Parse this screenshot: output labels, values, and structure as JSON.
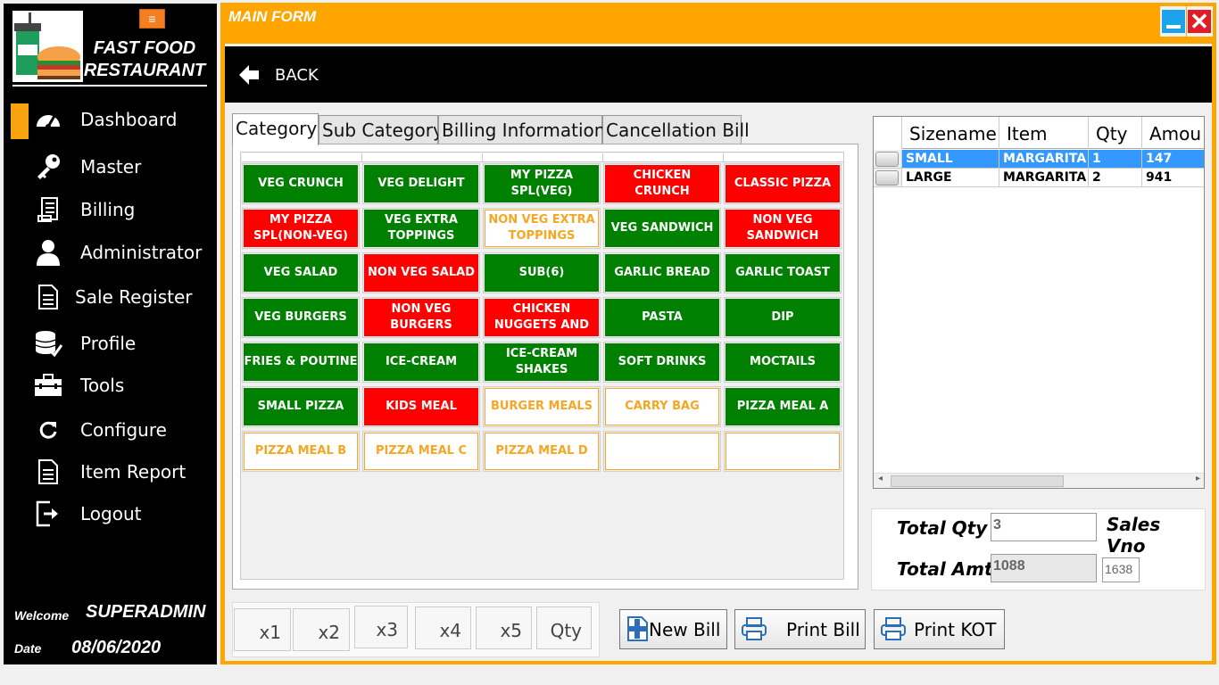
{
  "sidebar": {
    "brand": "FAST FOOD RESTAURANT",
    "menu_icon": "hamburger-icon",
    "items": [
      {
        "label": "Dashboard",
        "icon": "dashboard-gauge-icon"
      },
      {
        "label": "Master",
        "icon": "key-icon"
      },
      {
        "label": "Billing",
        "icon": "receipt-icon"
      },
      {
        "label": "Administrator",
        "icon": "user-icon"
      },
      {
        "label": "Sale Register",
        "icon": "document-icon"
      },
      {
        "label": "Profile",
        "icon": "database-check-icon"
      },
      {
        "label": "Tools",
        "icon": "toolbox-icon"
      },
      {
        "label": "Configure",
        "icon": "refresh-icon"
      },
      {
        "label": "Item Report",
        "icon": "document-icon"
      },
      {
        "label": "Logout",
        "icon": "logout-icon"
      }
    ],
    "welcome_label": "Welcome",
    "welcome_user": "SUPERADMIN",
    "date_label": "Date",
    "date_value": "08/06/2020",
    "accent_color": "#f7a20e"
  },
  "window": {
    "title": "MAIN FORM",
    "back_label": "BACK",
    "frame_color": "#ffa500"
  },
  "tabs": [
    "Category",
    "Sub Category",
    "Billing Information",
    "Cancellation Bill"
  ],
  "categories": [
    {
      "label": "VEG CRUNCH",
      "style": "green"
    },
    {
      "label": "VEG DELIGHT",
      "style": "green"
    },
    {
      "label": "MY PIZZA SPL(VEG)",
      "style": "green"
    },
    {
      "label": "CHICKEN CRUNCH",
      "style": "red"
    },
    {
      "label": "CLASSIC PIZZA",
      "style": "red"
    },
    {
      "label": "MY PIZZA SPL(NON-VEG)",
      "style": "red"
    },
    {
      "label": "VEG EXTRA TOPPINGS",
      "style": "green"
    },
    {
      "label": "NON VEG EXTRA TOPPINGS",
      "style": "white"
    },
    {
      "label": "VEG SANDWICH",
      "style": "green"
    },
    {
      "label": "NON VEG SANDWICH",
      "style": "red"
    },
    {
      "label": "VEG SALAD",
      "style": "green"
    },
    {
      "label": "NON VEG SALAD",
      "style": "red"
    },
    {
      "label": "SUB(6)",
      "style": "green"
    },
    {
      "label": "GARLIC BREAD",
      "style": "green"
    },
    {
      "label": "GARLIC TOAST",
      "style": "green"
    },
    {
      "label": "VEG BURGERS",
      "style": "green"
    },
    {
      "label": "NON VEG BURGERS",
      "style": "red"
    },
    {
      "label": "CHICKEN NUGGETS AND",
      "style": "red"
    },
    {
      "label": "PASTA",
      "style": "green"
    },
    {
      "label": "DIP",
      "style": "green"
    },
    {
      "label": "FRIES & POUTINE",
      "style": "green"
    },
    {
      "label": "ICE-CREAM",
      "style": "green"
    },
    {
      "label": "ICE-CREAM SHAKES",
      "style": "green"
    },
    {
      "label": "SOFT DRINKS",
      "style": "green"
    },
    {
      "label": "MOCTAILS",
      "style": "green"
    },
    {
      "label": "SMALL PIZZA",
      "style": "green"
    },
    {
      "label": "KIDS MEAL",
      "style": "red"
    },
    {
      "label": "BURGER MEALS",
      "style": "white"
    },
    {
      "label": "CARRY BAG",
      "style": "white"
    },
    {
      "label": "PIZZA MEAL A",
      "style": "green"
    },
    {
      "label": "PIZZA MEAL B",
      "style": "white"
    },
    {
      "label": "PIZZA MEAL C",
      "style": "white"
    },
    {
      "label": "PIZZA MEAL D",
      "style": "white"
    },
    {
      "label": "",
      "style": "white"
    },
    {
      "label": "",
      "style": "white"
    }
  ],
  "order": {
    "columns": [
      "Sizename",
      "Item",
      "Qty",
      "Amou"
    ],
    "rows": [
      {
        "size": "SMALL",
        "item": "MARGARITA",
        "qty": "1",
        "amount": "147",
        "selected": true
      },
      {
        "size": "LARGE",
        "item": "MARGARITA",
        "qty": "2",
        "amount": "941",
        "selected": false
      }
    ]
  },
  "totals": {
    "qty_label": "Total Qty",
    "qty_value": "3",
    "amt_label": "Total Amt",
    "amt_value": "1088",
    "sales_vno_label": "Sales Vno",
    "sales_vno_value": "1638"
  },
  "qty_buttons": [
    "x1",
    "x2",
    "x3",
    "x4",
    "x5",
    "Qty"
  ],
  "actions": {
    "new_bill": "New Bill",
    "print_bill": "Print Bill",
    "print_kot": "Print KOT"
  }
}
